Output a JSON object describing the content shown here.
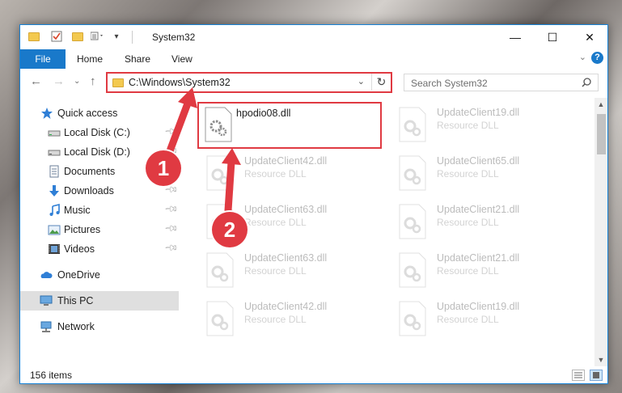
{
  "window": {
    "title": "System32",
    "controls": {
      "minimize": "—",
      "maximize": "☐",
      "close": "✕"
    }
  },
  "ribbon": {
    "file_tab": "File",
    "tabs": [
      "Home",
      "Share",
      "View"
    ],
    "help": "?"
  },
  "address_bar": {
    "path": "C:\\Windows\\System32"
  },
  "search": {
    "placeholder": "Search System32"
  },
  "sidebar": {
    "items": [
      {
        "label": "Quick access",
        "icon": "star-icon",
        "pinned": false
      },
      {
        "label": "Local Disk (C:)",
        "icon": "drive-icon",
        "pinned": true
      },
      {
        "label": "Local Disk (D:)",
        "icon": "drive-icon",
        "pinned": true
      },
      {
        "label": "Documents",
        "icon": "documents-icon",
        "pinned": true
      },
      {
        "label": "Downloads",
        "icon": "downloads-icon",
        "pinned": true
      },
      {
        "label": "Music",
        "icon": "music-icon",
        "pinned": true
      },
      {
        "label": "Pictures",
        "icon": "pictures-icon",
        "pinned": true
      },
      {
        "label": "Videos",
        "icon": "videos-icon",
        "pinned": true
      },
      {
        "label": "OneDrive",
        "icon": "cloud-icon",
        "pinned": false
      },
      {
        "label": "This PC",
        "icon": "computer-icon",
        "pinned": false,
        "selected": true
      },
      {
        "label": "Network",
        "icon": "network-icon",
        "pinned": false
      }
    ]
  },
  "files": [
    {
      "name": "hpodio08.dll",
      "type": "",
      "highlighted": true
    },
    {
      "name": "UpdateClient19.dll",
      "type": "Resource DLL"
    },
    {
      "name": "UpdateClient42.dll",
      "type": "Resource DLL"
    },
    {
      "name": "UpdateClient65.dll",
      "type": "Resource DLL"
    },
    {
      "name": "UpdateClient63.dll",
      "type": "Resource DLL"
    },
    {
      "name": "UpdateClient21.dll",
      "type": "Resource DLL"
    },
    {
      "name": "UpdateClient63.dll",
      "type": "Resource DLL"
    },
    {
      "name": "UpdateClient21.dll",
      "type": "Resource DLL"
    },
    {
      "name": "UpdateClient42.dll",
      "type": "Resource DLL"
    },
    {
      "name": "UpdateClient19.dll",
      "type": "Resource DLL"
    }
  ],
  "status": {
    "item_count": "156 items"
  },
  "annotations": {
    "step1": "1",
    "step2": "2"
  },
  "colors": {
    "accent": "#1979ca",
    "annotation": "#e03a42",
    "folder": "#f3c94f"
  }
}
